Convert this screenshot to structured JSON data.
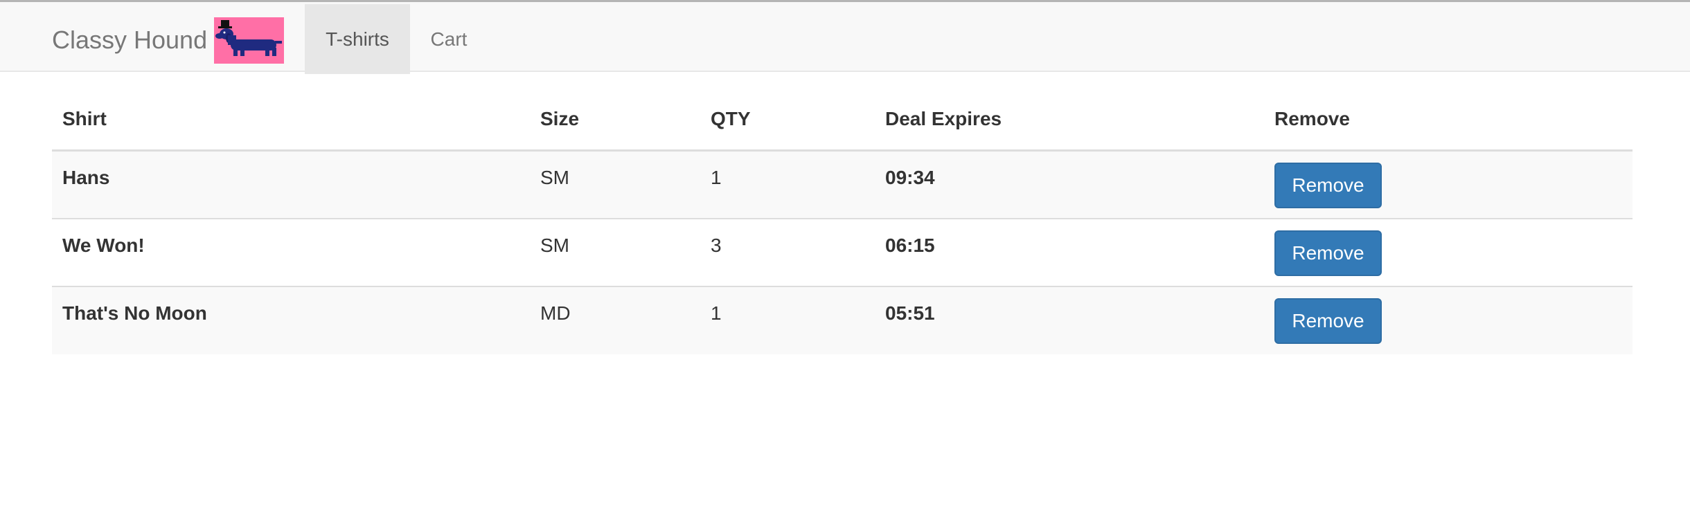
{
  "navbar": {
    "brand": "Classy Hound",
    "brand_logo_icon": "dachshund-logo",
    "tabs": [
      {
        "label": "T-shirts",
        "active": true
      },
      {
        "label": "Cart",
        "active": false
      }
    ]
  },
  "cart_table": {
    "headers": [
      "Shirt",
      "Size",
      "QTY",
      "Deal Expires",
      "Remove"
    ],
    "rows": [
      {
        "shirt": "Hans",
        "size": "SM",
        "qty": "1",
        "deal_expires": "09:34",
        "remove_label": "Remove"
      },
      {
        "shirt": "We Won!",
        "size": "SM",
        "qty": "3",
        "deal_expires": "06:15",
        "remove_label": "Remove"
      },
      {
        "shirt": "That's No Moon",
        "size": "MD",
        "qty": "1",
        "deal_expires": "05:51",
        "remove_label": "Remove"
      }
    ]
  },
  "colors": {
    "navbar_bg": "#f8f8f8",
    "active_tab_bg": "#e7e7e7",
    "logo_bg": "#ff6fa6",
    "button_primary": "#337ab7",
    "striped_row": "#f9f9f9"
  }
}
